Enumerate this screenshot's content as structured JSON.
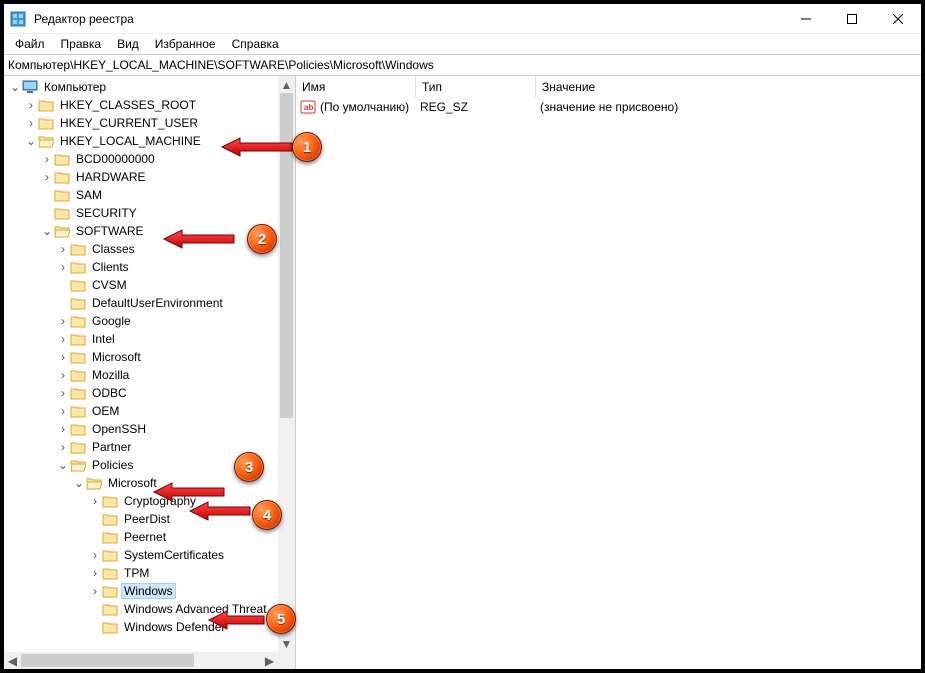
{
  "window": {
    "title": "Редактор реестра"
  },
  "menu": [
    "Файл",
    "Правка",
    "Вид",
    "Избранное",
    "Справка"
  ],
  "address": "Компьютер\\HKEY_LOCAL_MACHINE\\SOFTWARE\\Policies\\Microsoft\\Windows",
  "columns": {
    "name": "Имя",
    "type": "Тип",
    "value": "Значение"
  },
  "values": [
    {
      "name": "(По умолчанию)",
      "type": "REG_SZ",
      "value": "(значение не присвоено)"
    }
  ],
  "tree": {
    "root": "Компьютер",
    "hkcr": "HKEY_CLASSES_ROOT",
    "hkcu": "HKEY_CURRENT_USER",
    "hklm": "HKEY_LOCAL_MACHINE",
    "bcd": "BCD00000000",
    "hw": "HARDWARE",
    "sam": "SAM",
    "sec": "SECURITY",
    "sw": "SOFTWARE",
    "classes": "Classes",
    "clients": "Clients",
    "cvsm": "CVSM",
    "due": "DefaultUserEnvironment",
    "google": "Google",
    "intel": "Intel",
    "ms": "Microsoft",
    "moz": "Mozilla",
    "odbc": "ODBC",
    "oem": "OEM",
    "openssh": "OpenSSH",
    "partner": "Partner",
    "policies": "Policies",
    "pms": "Microsoft",
    "crypt": "Cryptography",
    "peerdist": "PeerDist",
    "peernet": "Peernet",
    "syscert": "SystemCertificates",
    "tpm": "TPM",
    "win": "Windows",
    "wat": "Windows Advanced Threat",
    "wd": "Windows Defender"
  },
  "annotations": [
    "1",
    "2",
    "3",
    "4",
    "5"
  ]
}
